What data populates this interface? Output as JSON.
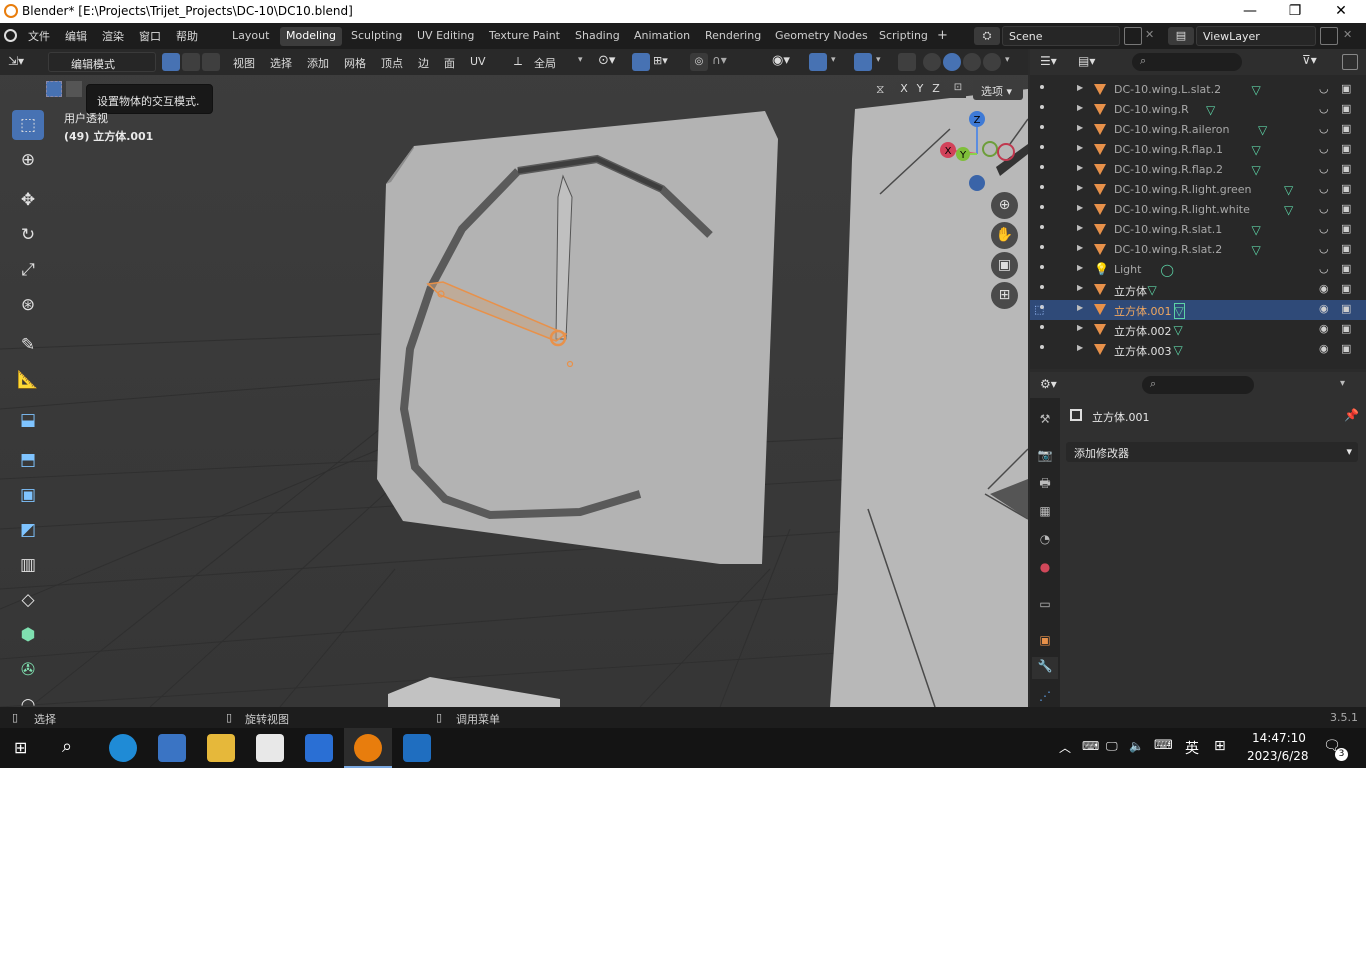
{
  "window": {
    "title": "Blender* [E:\\Projects\\Trijet_Projects\\DC-10\\DC10.blend]",
    "min": "—",
    "max": "❐",
    "close": "✕"
  },
  "menu": {
    "items": [
      "文件",
      "编辑",
      "渲染",
      "窗口",
      "帮助"
    ],
    "workspaces": [
      "Layout",
      "Modeling",
      "Sculpting",
      "UV Editing",
      "Texture Paint",
      "Shading",
      "Animation",
      "Rendering",
      "Geometry Nodes",
      "Scripting"
    ],
    "active_workspace": "Modeling",
    "add_tab": "+",
    "scene": "Scene",
    "view_layer": "ViewLayer"
  },
  "viewport_header": {
    "mode": "编辑模式",
    "menus": [
      "视图",
      "选择",
      "添加",
      "网格",
      "顶点",
      "边",
      "面",
      "UV"
    ],
    "transform_orientation": "全局",
    "axis_x": "X",
    "axis_y": "Y",
    "axis_z": "Z",
    "options": "选项"
  },
  "viewport": {
    "tooltip": "设置物体的交互模式.",
    "view_name": "用户透视",
    "object_info": "(49) 立方体.001"
  },
  "gizmo": {
    "z": "Z",
    "x": "X",
    "y": "Y"
  },
  "outliner": {
    "rows": [
      {
        "name": "DC-10.wing.L.slat.2",
        "dim": true
      },
      {
        "name": "DC-10.wing.R",
        "dim": true
      },
      {
        "name": "DC-10.wing.R.aileron",
        "dim": true
      },
      {
        "name": "DC-10.wing.R.flap.1",
        "dim": true
      },
      {
        "name": "DC-10.wing.R.flap.2",
        "dim": true
      },
      {
        "name": "DC-10.wing.R.light.green",
        "dim": true
      },
      {
        "name": "DC-10.wing.R.light.white",
        "dim": true
      },
      {
        "name": "DC-10.wing.R.slat.1",
        "dim": true
      },
      {
        "name": "DC-10.wing.R.slat.2",
        "dim": true
      },
      {
        "name": "Light",
        "dim": true
      },
      {
        "name": "立方体",
        "dim": false
      },
      {
        "name": "立方体.001",
        "dim": false,
        "selected": true
      },
      {
        "name": "立方体.002",
        "dim": false
      },
      {
        "name": "立方体.003",
        "dim": false
      }
    ]
  },
  "properties": {
    "object_name": "立方体.001",
    "add_modifier": "添加修改器"
  },
  "statusbar": {
    "select": "选择",
    "rotate": "旋转视图",
    "menu": "调用菜单",
    "version": "3.5.1"
  },
  "taskbar": {
    "time": "14:47:10",
    "date": "2023/6/28",
    "ime": "英",
    "notifications": "3"
  },
  "colors": {
    "accent": "#4772b3",
    "selected_orange": "#e8914a",
    "mesh_green": "#5dd3a6"
  }
}
